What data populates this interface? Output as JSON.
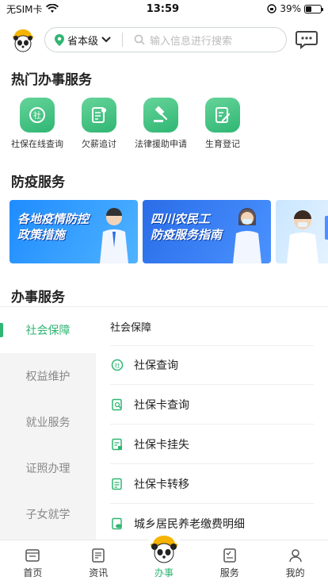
{
  "status_bar": {
    "carrier": "无SIM卡",
    "time": "13:59",
    "battery": "39%",
    "battery_level": 0.39
  },
  "header": {
    "region": "省本级",
    "search_placeholder": "输入信息进行搜索"
  },
  "hot_services": {
    "title": "热门办事服务",
    "items": [
      {
        "label": "社保在线查询",
        "icon": "social-security-icon"
      },
      {
        "label": "欠薪追讨",
        "icon": "wage-document-icon"
      },
      {
        "label": "法律援助申请",
        "icon": "legal-gavel-icon"
      },
      {
        "label": "生育登记",
        "icon": "registration-form-icon"
      }
    ]
  },
  "epidemic": {
    "title": "防疫服务",
    "banners": [
      {
        "text_line1": "各地疫情防控",
        "text_line2": "政策措施"
      },
      {
        "text_line1": "四川农民工",
        "text_line2": "防疫服务指南"
      },
      {
        "text_line1": "",
        "text_line2": ""
      }
    ]
  },
  "affairs": {
    "title": "办事服务",
    "nav": [
      {
        "label": "社会保障",
        "active": true
      },
      {
        "label": "权益维护",
        "active": false
      },
      {
        "label": "就业服务",
        "active": false
      },
      {
        "label": "证照办理",
        "active": false
      },
      {
        "label": "子女就学",
        "active": false
      }
    ],
    "list_heading": "社会保障",
    "list": [
      {
        "label": "社保查询",
        "icon": "social-security-icon"
      },
      {
        "label": "社保卡查询",
        "icon": "card-search-icon"
      },
      {
        "label": "社保卡挂失",
        "icon": "card-report-icon"
      },
      {
        "label": "社保卡转移",
        "icon": "card-transfer-icon"
      },
      {
        "label": "城乡居民养老缴费明细",
        "icon": "pension-icon"
      }
    ]
  },
  "tab_bar": {
    "tabs": [
      {
        "label": "首页",
        "icon": "home-icon",
        "active": false
      },
      {
        "label": "资讯",
        "icon": "news-icon",
        "active": false
      },
      {
        "label": "办事",
        "icon": "affairs-avatar-icon",
        "active": true
      },
      {
        "label": "服务",
        "icon": "service-icon",
        "active": false
      },
      {
        "label": "我的",
        "icon": "profile-icon",
        "active": false
      }
    ]
  },
  "colors": {
    "accent": "#2fb673",
    "banner_blue": "#1f8cff"
  }
}
